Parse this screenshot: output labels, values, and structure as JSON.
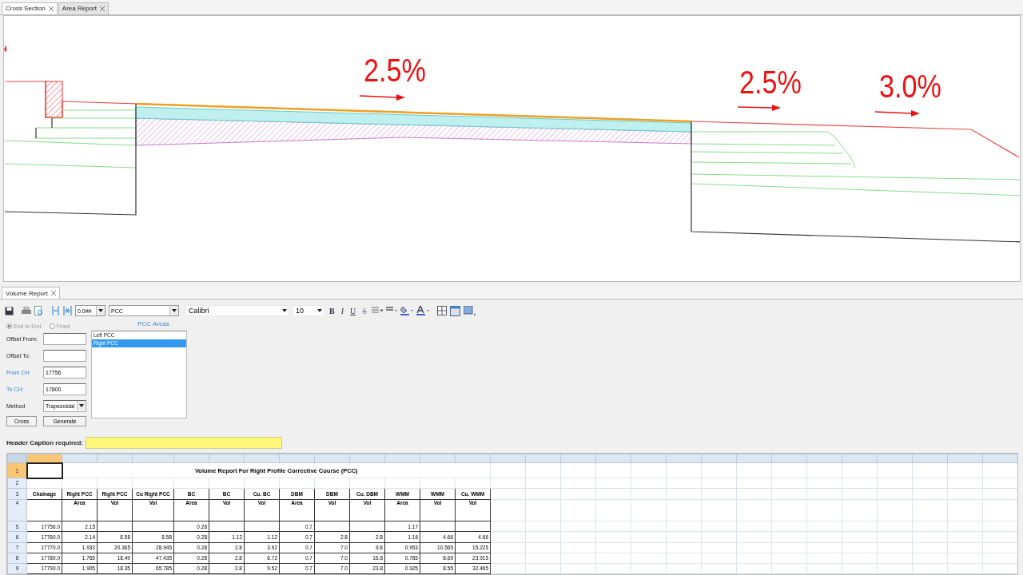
{
  "top_tabs": [
    {
      "label": "Cross Section",
      "selected": true
    },
    {
      "label": "Area Report",
      "selected": false
    }
  ],
  "cross_section": {
    "slope_labels": [
      "2.5%",
      "2.5%",
      "3.0%"
    ]
  },
  "report_tab": {
    "label": "Volume Report"
  },
  "toolbar": {
    "line_weight": "0.0##",
    "layer": "PCC",
    "font": "Calibri",
    "size": "10",
    "format_buttons": [
      "B",
      "I",
      "U",
      "S"
    ]
  },
  "radios": [
    {
      "label": "End to End",
      "selected": true,
      "disabled": true
    },
    {
      "label": "Fixed",
      "selected": false,
      "disabled": true
    }
  ],
  "areas": {
    "title": "PCC Areas",
    "items": [
      {
        "label": "Left PCC",
        "selected": false
      },
      {
        "label": "Right PCC",
        "selected": true
      }
    ]
  },
  "fields": [
    {
      "label": "Offset From:",
      "emphasis": false,
      "kind": "text"
    },
    {
      "label": "Offset To:",
      "emphasis": false,
      "kind": "text"
    },
    {
      "label": "From CH:",
      "value": "17756",
      "emphasis": true,
      "kind": "text"
    },
    {
      "label": "To CH:",
      "value": "17800",
      "emphasis": true,
      "kind": "text"
    },
    {
      "label": "Method",
      "value": "Trapezoidal",
      "emphasis": false,
      "kind": "select"
    }
  ],
  "buttons": [
    "Cross",
    "Generate"
  ],
  "header_caption": {
    "label": "Header Caption  required:"
  },
  "sheet": {
    "rows": [
      {
        "number": "1",
        "kind": "title",
        "selected": true,
        "text": "Volume Report For Right Profile Corrective Course (PCC)"
      },
      {
        "number": "2",
        "kind": "blank",
        "selected": false
      },
      {
        "number": "3",
        "kind": "header",
        "selected": false,
        "cells": [
          "Chainage",
          "Right PCC",
          "Right PCC",
          "Cu Right PCC",
          "BC",
          "BC",
          "Cu. BC",
          "DBM",
          "DBM",
          "Cu. DBM",
          "WMM",
          "WMM",
          "Cu. WMM"
        ]
      },
      {
        "number": "4",
        "kind": "subheader",
        "selected": false,
        "cells": [
          null,
          "Area",
          "Vol",
          "Vol",
          "Area",
          "Vol",
          "Vol",
          "Area",
          "Vol",
          "Vol",
          "Area",
          "Vol",
          "Vol"
        ]
      },
      {
        "number": "5",
        "kind": "data",
        "selected": false,
        "cells": [
          "17756.0",
          "2.15",
          null,
          null,
          "0.28",
          null,
          null,
          "0.7",
          null,
          null,
          "1.17",
          null,
          null
        ]
      },
      {
        "number": "6",
        "kind": "data",
        "selected": false,
        "cells": [
          "17760.0",
          "2.14",
          "8.58",
          "8.58",
          "0.28",
          "1.12",
          "1.12",
          "0.7",
          "2.8",
          "2.8",
          "1.16",
          "4.66",
          "4.66"
        ]
      },
      {
        "number": "7",
        "kind": "data",
        "selected": false,
        "cells": [
          "17770.0",
          "1.933",
          "20.365",
          "28.945",
          "0.28",
          "2.8",
          "3.92",
          "0.7",
          "7.0",
          "9.8",
          "0.953",
          "10.565",
          "15.225"
        ]
      },
      {
        "number": "8",
        "kind": "data",
        "selected": false,
        "cells": [
          "17780.0",
          "1.765",
          "18.49",
          "47.435",
          "0.28",
          "2.8",
          "6.72",
          "0.7",
          "7.0",
          "16.8",
          "0.785",
          "8.69",
          "23.915"
        ]
      },
      {
        "number": "9",
        "kind": "data",
        "selected": false,
        "cells": [
          "17790.0",
          "1.905",
          "18.35",
          "65.785",
          "0.28",
          "2.8",
          "9.52",
          "0.7",
          "7.0",
          "23.8",
          "0.925",
          "8.55",
          "32.465"
        ]
      }
    ]
  }
}
